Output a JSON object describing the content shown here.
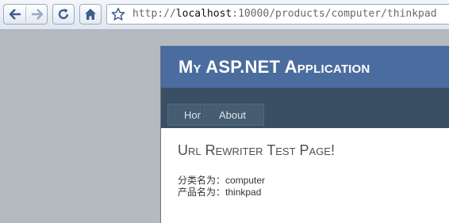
{
  "browser": {
    "url_prefix": "http://",
    "url_host": "localhost",
    "url_rest": ":10000/products/computer/thinkpad"
  },
  "icons": [
    "back-arrow-icon",
    "forward-arrow-icon",
    "reload-icon",
    "home-icon",
    "star-icon"
  ],
  "app": {
    "title": "My ASP.NET Application",
    "menu": [
      "Home",
      "About"
    ]
  },
  "main": {
    "heading": "Url Rewriter Test Page!",
    "category_label": "分类名为：",
    "category_value": "computer",
    "product_label": "产品名为：",
    "product_value": "thinkpad"
  },
  "colors": {
    "header": "#4b6c9e",
    "menubar": "#3a4f63",
    "menu_item": "#465c71"
  }
}
